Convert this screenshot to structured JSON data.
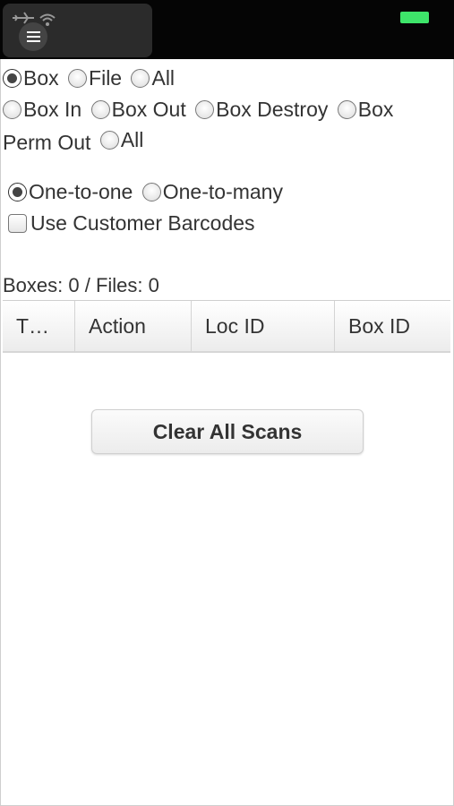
{
  "filter_type": {
    "options": [
      {
        "label": "Box",
        "checked": true
      },
      {
        "label": "File",
        "checked": false
      },
      {
        "label": "All",
        "checked": false
      }
    ]
  },
  "action_type": {
    "options": [
      {
        "label": "Box In",
        "checked": false
      },
      {
        "label": "Box Out",
        "checked": false
      },
      {
        "label": "Box Destroy",
        "checked": false
      },
      {
        "label": "Box Perm Out",
        "checked": false
      },
      {
        "label": "All",
        "checked": false
      }
    ],
    "wrap_first": "Box",
    "wrap_second": "Perm Out"
  },
  "mapping": {
    "options": [
      {
        "label": "One-to-one",
        "checked": true
      },
      {
        "label": "One-to-many",
        "checked": false
      }
    ]
  },
  "customer_barcodes": {
    "label": "Use Customer Barcodes",
    "checked": false
  },
  "summary": "Boxes: 0 / Files: 0",
  "table": {
    "columns": [
      "T…",
      "Action",
      "Loc ID",
      "Box ID"
    ],
    "rows": []
  },
  "clear_button": "Clear All Scans",
  "colors": {
    "battery": "#3ee56a",
    "statusbar": "#050505"
  },
  "icons": [
    "menu-icon",
    "airplane-icon",
    "wifi-icon",
    "battery-icon"
  ]
}
